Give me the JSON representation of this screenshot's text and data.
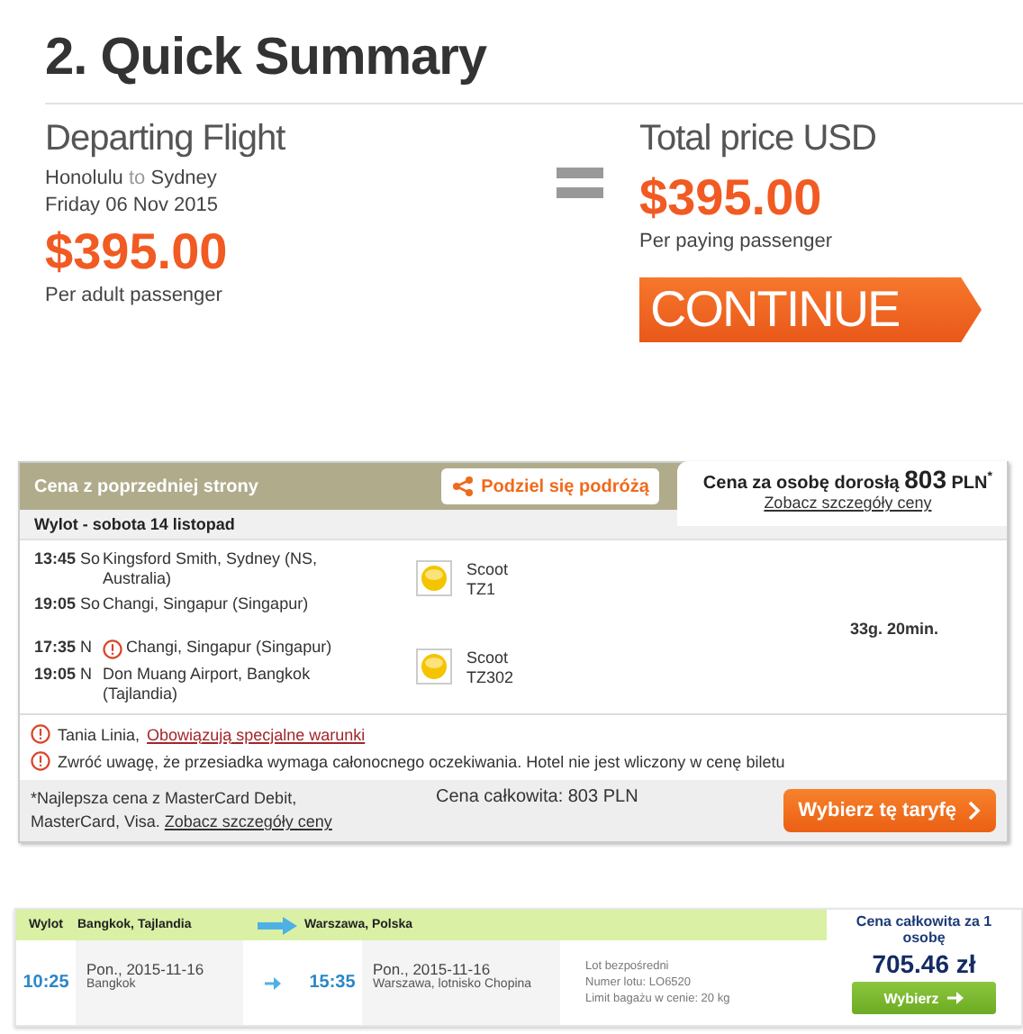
{
  "summary": {
    "title": "2. Quick Summary",
    "departing": {
      "heading": "Departing Flight",
      "from": "Honolulu",
      "connector": "to",
      "to": "Sydney",
      "date": "Friday 06 Nov 2015",
      "price": "$395.00",
      "note": "Per adult passenger"
    },
    "total": {
      "heading": "Total price USD",
      "price": "$395.00",
      "note": "Per paying passenger"
    },
    "continue_button": "CONTINUE"
  },
  "fare_card": {
    "header_title": "Cena z poprzedniej strony",
    "share_button": "Podziel się podróżą",
    "price_tab": {
      "label": "Cena za osobę dorosłą",
      "amount": "803",
      "currency": "PLN",
      "mark": "*",
      "details_link": "Zobacz szczegóły ceny"
    },
    "departure_label": "Wylot - sobota 14 listopad",
    "segments": [
      {
        "legs": [
          {
            "time": "13:45",
            "day": "So",
            "place": "Kingsford Smith, Sydney (NS, Australia)",
            "warning": false
          },
          {
            "time": "19:05",
            "day": "So",
            "place": "Changi, Singapur (Singapur)",
            "warning": false
          }
        ],
        "airline": "Scoot",
        "flight": "TZ1"
      },
      {
        "legs": [
          {
            "time": "17:35",
            "day": "N",
            "place": "Changi, Singapur (Singapur)",
            "warning": true
          },
          {
            "time": "19:05",
            "day": "N",
            "place": "Don Muang Airport, Bangkok (Tajlandia)",
            "warning": false
          }
        ],
        "airline": "Scoot",
        "flight": "TZ302"
      }
    ],
    "duration": "33g. 20min.",
    "notices": [
      {
        "text": "Tania Linia,",
        "link": "Obowiązują specjalne warunki"
      },
      {
        "text": "Zwróć uwagę, że przesiadka wymaga całonocnego oczekiwania. Hotel nie jest wliczony w cenę biletu"
      }
    ],
    "footer": {
      "note": "*Najlepsza cena z MasterCard Debit, MasterCard, Visa.",
      "note_link": "Zobacz szczegóły ceny",
      "total": "Cena całkowita: 803 PLN",
      "select_button": "Wybierz tę taryfę"
    }
  },
  "offer": {
    "header": {
      "label": "Wylot",
      "from": "Bangkok, Tajlandia",
      "to": "Warszawa, Polska"
    },
    "departure": {
      "time": "10:25",
      "date": "Pon., 2015-11-16",
      "place": "Bangkok"
    },
    "arrival": {
      "time": "15:35",
      "date": "Pon., 2015-11-16",
      "place": "Warszawa, lotnisko Chopina"
    },
    "details": [
      "Lot bezpośredni",
      "Numer lotu: LO6520",
      "Limit bagażu w cenie: 20 kg"
    ],
    "price_label": "Cena całkowita za 1 osobę",
    "price": "705.46 zł",
    "select_button": "Wybierz"
  }
}
